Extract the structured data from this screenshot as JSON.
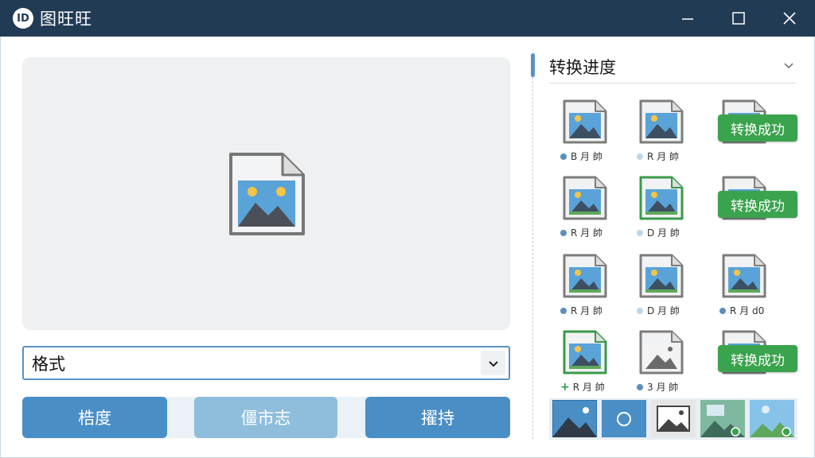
{
  "window": {
    "title": "图旺旺",
    "logo_text": "ID",
    "controls": [
      "minimize-icon",
      "maximize-icon",
      "close-icon"
    ]
  },
  "preview": {
    "icon": "image-file-icon"
  },
  "format": {
    "label": "格式",
    "icon": "chevron-down-icon"
  },
  "actions": [
    {
      "label": "梏度"
    },
    {
      "label": "僵市志"
    },
    {
      "label": "擢持"
    }
  ],
  "panel": {
    "title": "转换进度",
    "collapse_icon": "chevron-down-icon"
  },
  "thumbnails": [
    {
      "caption": "B 月 帥",
      "badge": "",
      "dot_color": "#5a8fbf"
    },
    {
      "caption": "R 月 帥",
      "badge": "",
      "dot_color": "#bcd7ea"
    },
    {
      "caption": "",
      "badge": "转换成功",
      "dot_color": ""
    },
    {
      "caption": "R 月 帥",
      "badge": "",
      "dot_color": "#5a8fbf"
    },
    {
      "caption": "D 月 帥",
      "badge": "",
      "dot_color": "#bcd7ea"
    },
    {
      "caption": "",
      "badge": "转换成功",
      "dot_color": ""
    },
    {
      "caption": "R 月 帥",
      "badge": "",
      "dot_color": "#5a8fbf"
    },
    {
      "caption": "D 月 帥",
      "badge": "",
      "dot_color": "#bcd7ea"
    },
    {
      "caption": "R 月 d0",
      "badge": "",
      "dot_color": "#5a8fbf"
    },
    {
      "caption": "R 月 帥",
      "badge": "",
      "dot_color": "plus"
    },
    {
      "caption": "3 月 帥",
      "badge": "",
      "dot_color": "#5a8fbf"
    },
    {
      "caption": "",
      "badge": "转换成功",
      "dot_color": ""
    }
  ],
  "strip": {
    "items": [
      "mountain-image-icon",
      "circle-icon",
      "image-frame-icon",
      "nature-image-icon",
      "nature-image-icon"
    ]
  },
  "colors": {
    "titlebar": "#223b55",
    "accent": "#4a8ec6",
    "success": "#3aa34d"
  }
}
